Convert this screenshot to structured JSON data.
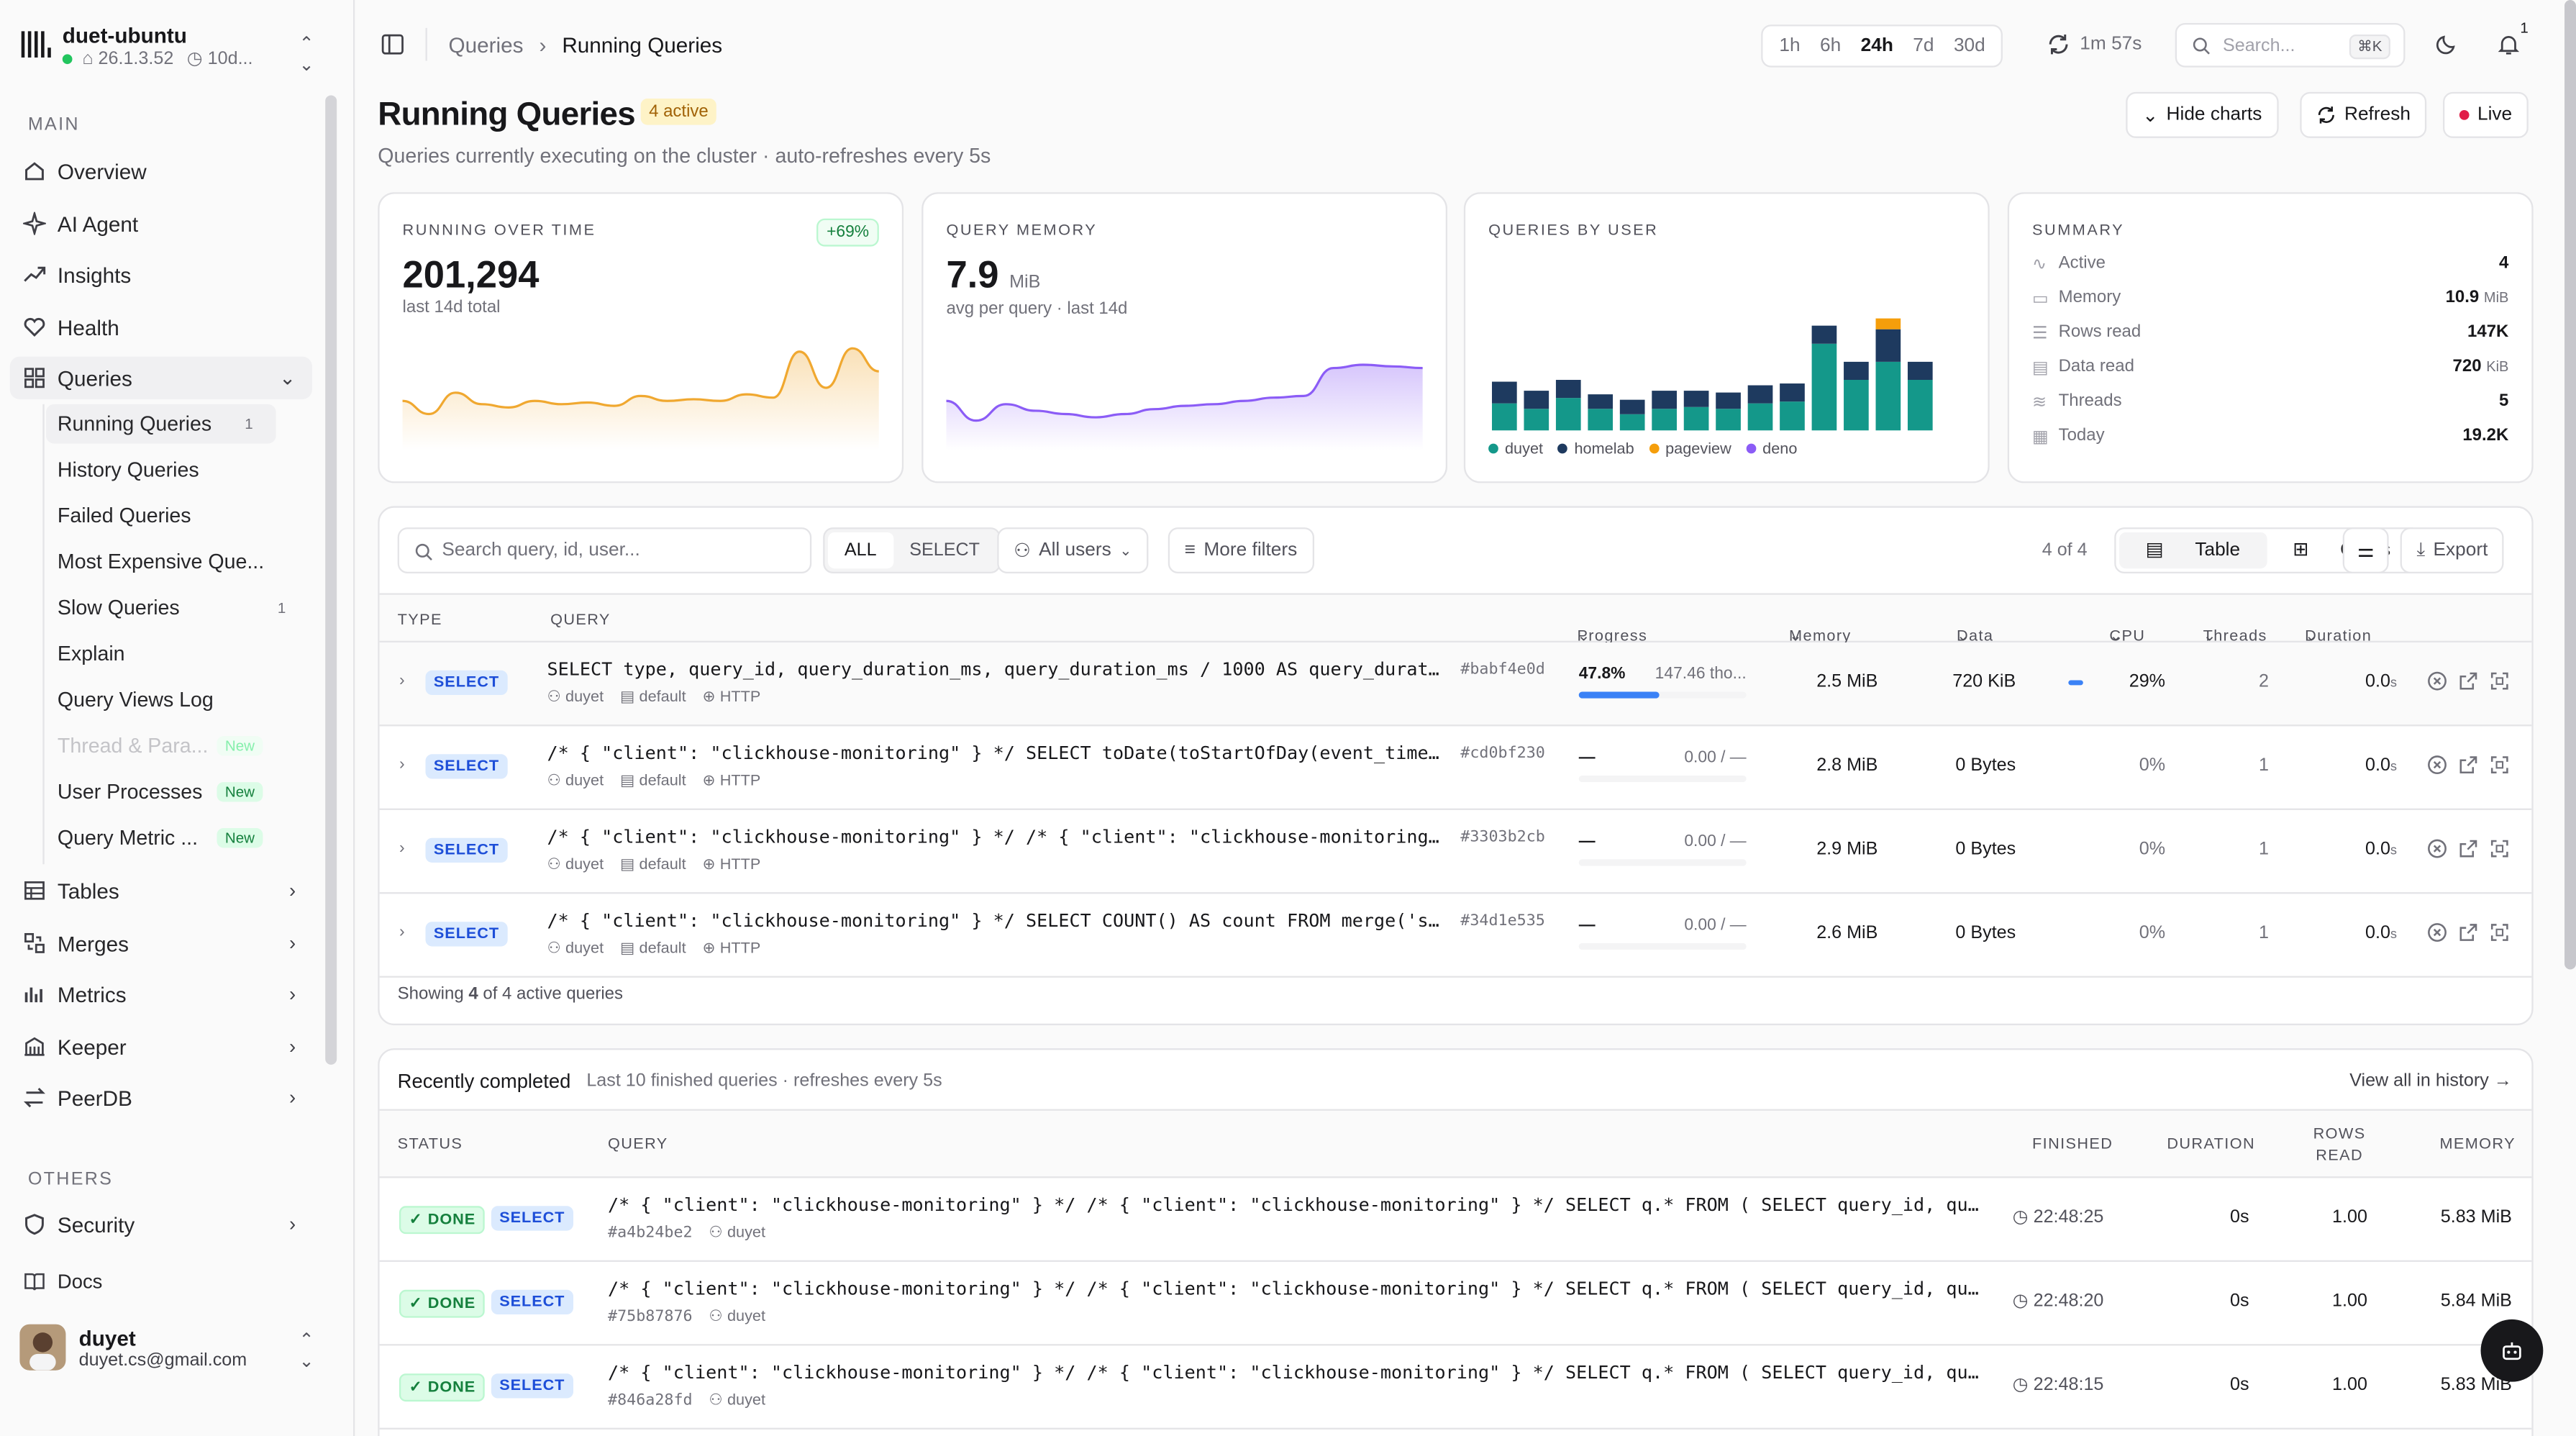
{
  "brand": {
    "name": "duet-ubuntu",
    "version": "26.1.3.52",
    "uptime": "10d..."
  },
  "nav": {
    "main_label": "MAIN",
    "items": [
      {
        "label": "Overview",
        "icon": "home-icon"
      },
      {
        "label": "AI Agent",
        "icon": "sparkles-icon"
      },
      {
        "label": "Insights",
        "icon": "trending-icon"
      },
      {
        "label": "Health",
        "icon": "heart-icon"
      },
      {
        "label": "Queries",
        "icon": "grid-icon"
      }
    ],
    "subitems": [
      {
        "label": "Running Queries",
        "count": "1"
      },
      {
        "label": "History Queries"
      },
      {
        "label": "Failed Queries"
      },
      {
        "label": "Most Expensive Que..."
      },
      {
        "label": "Slow Queries",
        "count": "1"
      },
      {
        "label": "Explain"
      },
      {
        "label": "Query Views Log"
      },
      {
        "label": "Thread & Para...",
        "badge": "New"
      },
      {
        "label": "User Processes",
        "badge": "New"
      },
      {
        "label": "Query Metric ...",
        "badge": "New"
      }
    ],
    "groups": [
      {
        "label": "Tables"
      },
      {
        "label": "Merges"
      },
      {
        "label": "Metrics"
      },
      {
        "label": "Keeper"
      },
      {
        "label": "PeerDB"
      }
    ],
    "others_label": "OTHERS",
    "security": "Security",
    "docs": "Docs"
  },
  "user": {
    "name": "duyet",
    "email": "duyet.cs@gmail.com"
  },
  "topbar": {
    "breadcrumb_parent": "Queries",
    "breadcrumb_current": "Running Queries",
    "ranges": [
      "1h",
      "6h",
      "24h",
      "7d",
      "30d"
    ],
    "range_selected": "24h",
    "refresh_timer": "1m 57s",
    "search_placeholder": "Search...",
    "search_kbd": "⌘K",
    "notifications": "1"
  },
  "page": {
    "title": "Running Queries",
    "active_badge": "4 active",
    "subtitle": "Queries currently executing on the cluster · auto-refreshes every 5s",
    "btn_hide": "Hide charts",
    "btn_refresh": "Refresh",
    "btn_live": "Live"
  },
  "cards": {
    "running": {
      "label": "RUNNING OVER TIME",
      "value": "201,294",
      "note": "last 14d total",
      "change": "+69%"
    },
    "memory": {
      "label": "QUERY MEMORY",
      "value": "7.9",
      "unit": "MiB",
      "note": "avg per query · last 14d"
    },
    "byuser": {
      "label": "QUERIES BY USER",
      "legend": [
        "duyet",
        "homelab",
        "pageview",
        "deno"
      ]
    },
    "summary": {
      "label": "SUMMARY",
      "rows": [
        {
          "k": "Active",
          "v": "4",
          "u": ""
        },
        {
          "k": "Memory",
          "v": "10.9",
          "u": "MiB"
        },
        {
          "k": "Rows read",
          "v": "147K",
          "u": ""
        },
        {
          "k": "Data read",
          "v": "720",
          "u": "KiB"
        },
        {
          "k": "Threads",
          "v": "5",
          "u": ""
        },
        {
          "k": "Today",
          "v": "19.2K",
          "u": ""
        }
      ]
    }
  },
  "colors": {
    "teal": "#14988a",
    "navy": "#1e3a5f",
    "amber": "#f59e0b",
    "purple": "#8b5cf6",
    "orange": "#f0a830"
  },
  "table": {
    "search_placeholder": "Search query, id, user...",
    "filters": [
      "ALL",
      "SELECT"
    ],
    "users": "All users",
    "more": "More filters",
    "count": "4 of 4",
    "view_table": "Table",
    "view_cards": "Cards",
    "export": "Export",
    "columns": [
      "TYPE",
      "QUERY",
      "Progress",
      "Memory",
      "Data",
      "CPU",
      "Threads",
      "Duration"
    ],
    "rows": [
      {
        "type": "SELECT",
        "query": "SELECT type, query_id, query_duration_ms, query_duration_ms / 1000 AS query_duration_s, event_time FROM system.query_log",
        "hash": "#babf4e0d",
        "user": "duyet",
        "db": "default",
        "iface": "HTTP",
        "progress": "47.8%",
        "progress_value": 0.478,
        "progress_detail": "147.46 tho...",
        "memory": "2.5 MiB",
        "data": "720 KiB",
        "cpu": "29%",
        "cpu_value": 0.29,
        "threads": "2",
        "duration": "0.0",
        "unit": "s"
      },
      {
        "type": "SELECT",
        "query": "/* { \"client\": \"clickhouse-monitoring\" } */ SELECT toDate(toStartOfDay(event_time)) AS day",
        "hash": "#cd0bf230",
        "user": "duyet",
        "db": "default",
        "iface": "HTTP",
        "progress": "—",
        "progress_value": 0,
        "progress_detail": "0.00 / —",
        "memory": "2.8 MiB",
        "data": "0 Bytes",
        "cpu": "0%",
        "cpu_value": 0,
        "threads": "1",
        "duration": "0.0",
        "unit": "s"
      },
      {
        "type": "SELECT",
        "query": "/* { \"client\": \"clickhouse-monitoring\" } */ /* { \"client\": \"clickhouse-monitoring\" } */ SELECT",
        "hash": "#3303b2cb",
        "user": "duyet",
        "db": "default",
        "iface": "HTTP",
        "progress": "—",
        "progress_value": 0,
        "progress_detail": "0.00 / —",
        "memory": "2.9 MiB",
        "data": "0 Bytes",
        "cpu": "0%",
        "cpu_value": 0,
        "threads": "1",
        "duration": "0.0",
        "unit": "s"
      },
      {
        "type": "SELECT",
        "query": "/* { \"client\": \"clickhouse-monitoring\" } */ SELECT COUNT() AS count FROM merge('system', 'query_log')",
        "hash": "#34d1e535",
        "user": "duyet",
        "db": "default",
        "iface": "HTTP",
        "progress": "—",
        "progress_value": 0,
        "progress_detail": "0.00 / —",
        "memory": "2.6 MiB",
        "data": "0 Bytes",
        "cpu": "0%",
        "cpu_value": 0,
        "threads": "1",
        "duration": "0.0",
        "unit": "s"
      }
    ],
    "footer_pre": "Showing ",
    "footer_n": "4",
    "footer_post": " of 4 active queries"
  },
  "recent": {
    "title": "Recently completed",
    "subtitle": "Last 10 finished queries · refreshes every 5s",
    "link": "View all in history",
    "columns": [
      "STATUS",
      "QUERY",
      "FINISHED",
      "DURATION",
      "ROWS READ",
      "MEMORY"
    ],
    "rows": [
      {
        "status": "DONE",
        "type": "SELECT",
        "query": "/* { \"client\": \"clickhouse-monitoring\" } */ /* { \"client\": \"clickhouse-monitoring\" } */ SELECT q.* FROM ( SELECT query_id, query_duration_ms",
        "hash": "#a4b24be2",
        "user": "duyet",
        "finished": "22:48:25",
        "duration": "0s",
        "rows": "1.00",
        "memory": "5.83 MiB"
      },
      {
        "status": "DONE",
        "type": "SELECT",
        "query": "/* { \"client\": \"clickhouse-monitoring\" } */ /* { \"client\": \"clickhouse-monitoring\" } */ SELECT q.* FROM ( SELECT query_id, query_duration_ms",
        "hash": "#75b87876",
        "user": "duyet",
        "finished": "22:48:20",
        "duration": "0s",
        "rows": "1.00",
        "memory": "5.84 MiB"
      },
      {
        "status": "DONE",
        "type": "SELECT",
        "query": "/* { \"client\": \"clickhouse-monitoring\" } */ /* { \"client\": \"clickhouse-monitoring\" } */ SELECT q.* FROM ( SELECT query_id, query_duration_ms",
        "hash": "#846a28fd",
        "user": "duyet",
        "finished": "22:48:15",
        "duration": "0s",
        "rows": "1.00",
        "memory": "5.83 MiB"
      }
    ]
  },
  "chart_data": [
    {
      "type": "area",
      "series": [
        {
          "values": [
            30,
            22,
            35,
            28,
            26,
            30,
            28,
            29,
            27,
            33,
            30,
            31,
            30,
            34,
            32,
            60,
            38,
            62,
            48
          ]
        }
      ]
    },
    {
      "type": "area",
      "series": [
        {
          "values": [
            30,
            18,
            28,
            24,
            22,
            20,
            22,
            25,
            27,
            28,
            30,
            32,
            33,
            50,
            52,
            51,
            50
          ]
        }
      ]
    },
    {
      "type": "bar",
      "categories": [
        "1",
        "2",
        "3",
        "4",
        "5",
        "6",
        "7",
        "8",
        "9",
        "10",
        "11",
        "12",
        "13",
        "14",
        "15"
      ],
      "series": [
        {
          "name": "duyet",
          "values": [
            15,
            12,
            18,
            12,
            9,
            12,
            13,
            12,
            15,
            16,
            48,
            28,
            38,
            28,
            0
          ]
        },
        {
          "name": "homelab",
          "values": [
            12,
            10,
            10,
            8,
            8,
            10,
            9,
            9,
            10,
            10,
            10,
            10,
            18,
            10,
            0
          ]
        },
        {
          "name": "pageview",
          "values": [
            0,
            0,
            0,
            0,
            0,
            0,
            0,
            0,
            0,
            0,
            0,
            0,
            6,
            0,
            0
          ]
        },
        {
          "name": "deno",
          "values": [
            0,
            0,
            0,
            0,
            0,
            0,
            0,
            0,
            0,
            0,
            0,
            0,
            0,
            0,
            0
          ]
        }
      ]
    }
  ]
}
